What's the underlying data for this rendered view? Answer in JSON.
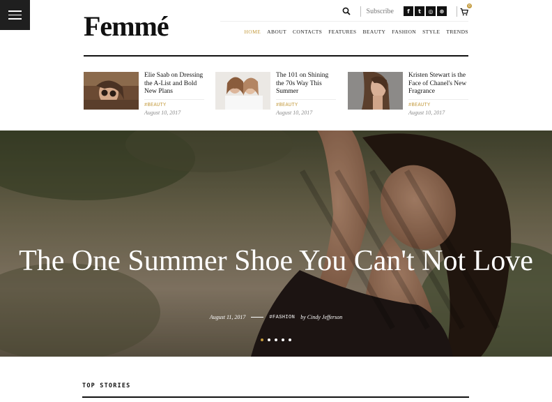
{
  "brand": {
    "logo": "Femmé",
    "accent": "#c39a3d"
  },
  "utilities": {
    "search_icon": "search-icon",
    "subscribe_label": "Subscribe",
    "socials": [
      {
        "name": "facebook-icon",
        "glyph": "f"
      },
      {
        "name": "twitter-icon",
        "glyph": "t"
      },
      {
        "name": "instagram-icon",
        "glyph": "◎"
      },
      {
        "name": "dribbble-icon",
        "glyph": "⊛"
      }
    ],
    "cart_icon": "cart-icon",
    "cart_count": "0"
  },
  "nav": {
    "items": [
      "HOME",
      "ABOUT",
      "CONTACTS",
      "FEATURES",
      "BEAUTY",
      "FASHION",
      "STYLE",
      "TRENDS"
    ],
    "active": "HOME"
  },
  "featured": [
    {
      "title": "Elie Saab on Dressing the A-List and Bold New Plans",
      "tag": "#BEAUTY",
      "date": "August 10, 2017"
    },
    {
      "title": "The 101 on Shining the 70s Way This Summer",
      "tag": "#BEAUTY",
      "date": "August 10, 2017"
    },
    {
      "title": "Kristen Stewart is the Face of Chanel's New Fragrance",
      "tag": "#BEAUTY",
      "date": "August 10, 2017"
    }
  ],
  "hero": {
    "title": "The One Summer Shoe You Can't Not Love",
    "date": "August 11, 2017",
    "tag": "#FASHION",
    "author": "by Cindy Jefferson",
    "slides": 5,
    "active_slide": 1
  },
  "top_stories": {
    "title": "TOP STORIES"
  }
}
